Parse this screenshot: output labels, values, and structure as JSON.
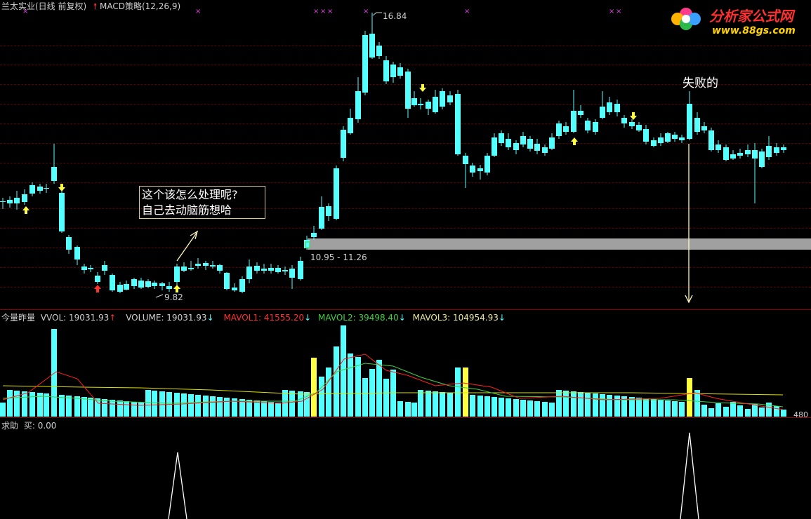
{
  "header": {
    "stock_name": "兰太实业(日线 前复权)",
    "strategy": "MACD策略(12,26,9)"
  },
  "price_chart": {
    "high_label": "16.84",
    "low_label": "9.82",
    "zone_label": "10.95 - 11.26",
    "failed_label": "失败的",
    "note_line1": "这个该怎么处理呢?",
    "note_line2": "自己去动脑筋想哈"
  },
  "volume_panel": {
    "title": "今量昨量",
    "vvol": "VVOL: 19031.93",
    "volume": "VOLUME: 19031.93",
    "mavol1": "MAVOL1: 41555.20",
    "mavol2": "MAVOL2: 39498.40",
    "mavol3": "MAVOL3: 104954.93",
    "scale": "480"
  },
  "signal_panel": {
    "title": "求助",
    "buy": "买: 0.00"
  },
  "logo": {
    "name": "分析家公式网",
    "url": "www.88gs.com"
  },
  "colors": {
    "up": "#ff3030",
    "down": "#54ffff",
    "mavol1": "#ff2020",
    "mavol2": "#40d040",
    "mavol3": "#e0e000",
    "highlight": "#ffff40",
    "gray_band": "#a0a0a0"
  }
}
